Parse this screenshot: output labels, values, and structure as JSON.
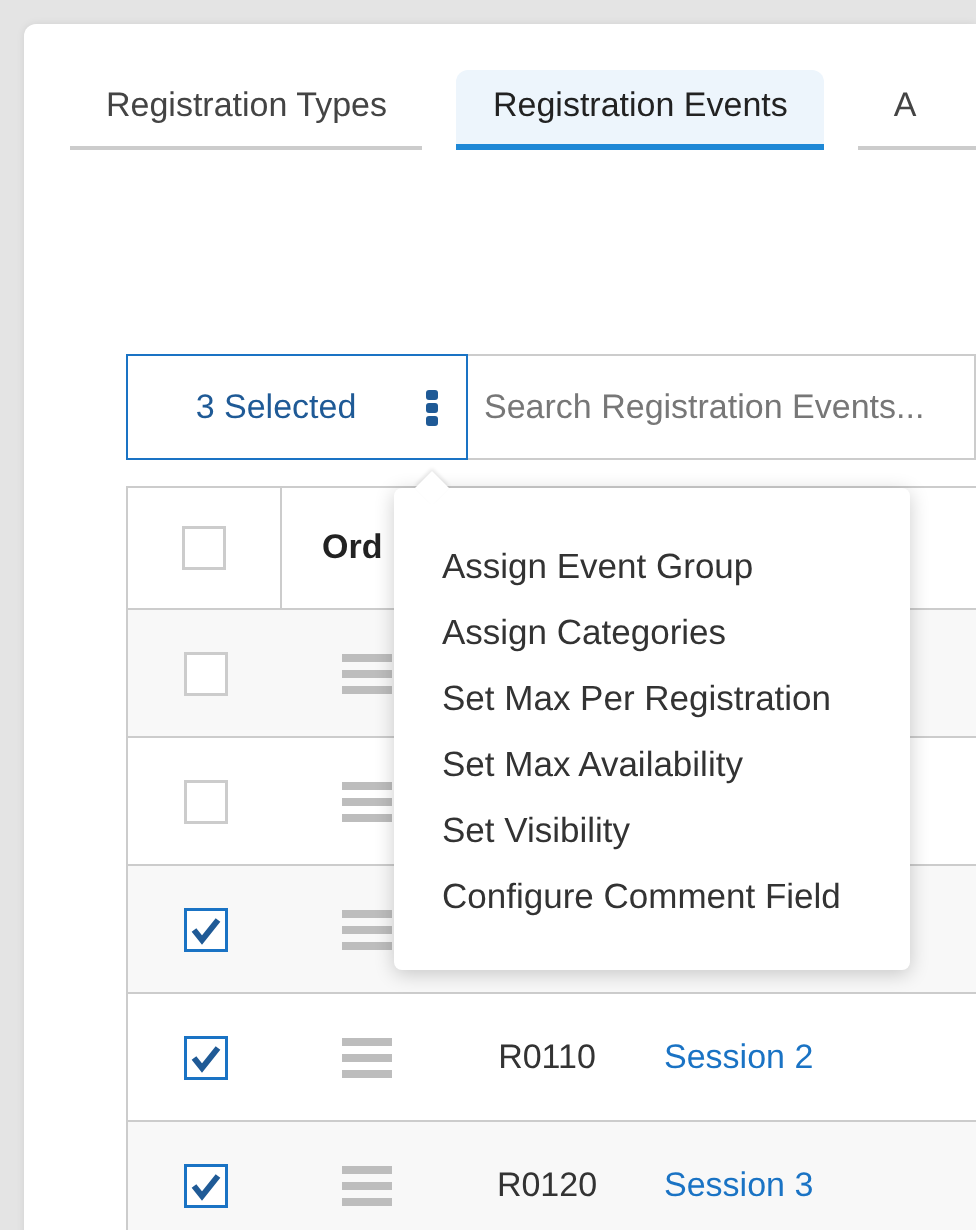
{
  "tabs": [
    {
      "label": "Registration Types",
      "selected": false
    },
    {
      "label": "Registration Events",
      "selected": true
    },
    {
      "label": "A",
      "selected": false
    }
  ],
  "bulk_actions": {
    "label": "3 Selected"
  },
  "search": {
    "placeholder": "Search Registration Events..."
  },
  "table": {
    "header_checked": false,
    "columns": [
      "Ord"
    ],
    "rows": [
      {
        "checked": false
      },
      {
        "checked": false
      },
      {
        "checked": true
      },
      {
        "checked": true,
        "code": "R0110",
        "name": "Session 2"
      },
      {
        "checked": true,
        "code": "R0120",
        "name": "Session 3"
      }
    ]
  },
  "menu": {
    "items": [
      "Assign Event Group",
      "Assign Categories",
      "Set Max Per Registration",
      "Set Max Availability",
      "Set Visibility",
      "Configure Comment Field"
    ]
  }
}
